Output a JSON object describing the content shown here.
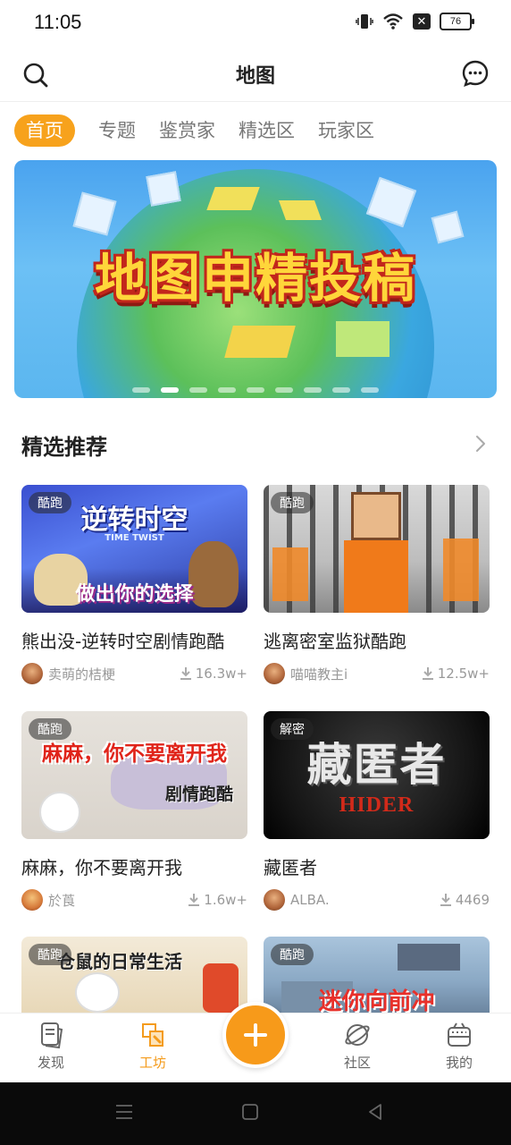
{
  "status": {
    "time": "11:05",
    "battery": "76",
    "sim": "✕"
  },
  "header": {
    "title": "地图"
  },
  "tabs": [
    {
      "label": "首页",
      "active": true
    },
    {
      "label": "专题",
      "active": false
    },
    {
      "label": "鉴赏家",
      "active": false
    },
    {
      "label": "精选区",
      "active": false
    },
    {
      "label": "玩家区",
      "active": false
    }
  ],
  "banner": {
    "headline": "地图申精投稿",
    "slide_count": 9,
    "active_slide": 2
  },
  "section": {
    "title": "精选推荐"
  },
  "cards": [
    {
      "tag": "酷跑",
      "thumb_title": "逆转时空",
      "thumb_sub": "做出你的选择",
      "thumb_en": "TIME TWIST",
      "name": "熊出没-逆转时空剧情跑酷",
      "author": "卖萌的桔梗",
      "downloads": "16.3w+"
    },
    {
      "tag": "酷跑",
      "name": "逃离密室监狱酷跑",
      "author": "喵喵教主i",
      "downloads": "12.5w+"
    },
    {
      "tag": "酷跑",
      "thumb_title": "麻麻，你不要离开我",
      "thumb_sub": "剧情跑酷",
      "name": "麻麻，你不要离开我",
      "author": "於莨",
      "downloads": "1.6w+"
    },
    {
      "tag": "解密",
      "thumb_title": "藏匿者",
      "thumb_en": "HIDER",
      "name": "藏匿者",
      "author": "ALBA.",
      "downloads": "4469"
    },
    {
      "tag": "酷跑",
      "thumb_title": "仓鼠的日常生活"
    },
    {
      "tag": "酷跑",
      "thumb_title": "迷你向前冲"
    }
  ],
  "bottom_nav": [
    {
      "label": "发现",
      "icon": "discover-icon",
      "active": false
    },
    {
      "label": "工坊",
      "icon": "workshop-icon",
      "active": true
    },
    {
      "label": "社区",
      "icon": "planet-icon",
      "active": false
    },
    {
      "label": "我的",
      "icon": "profile-icon",
      "active": false
    }
  ],
  "colors": {
    "accent": "#f7a21c",
    "text": "#222222",
    "muted": "#999999"
  }
}
